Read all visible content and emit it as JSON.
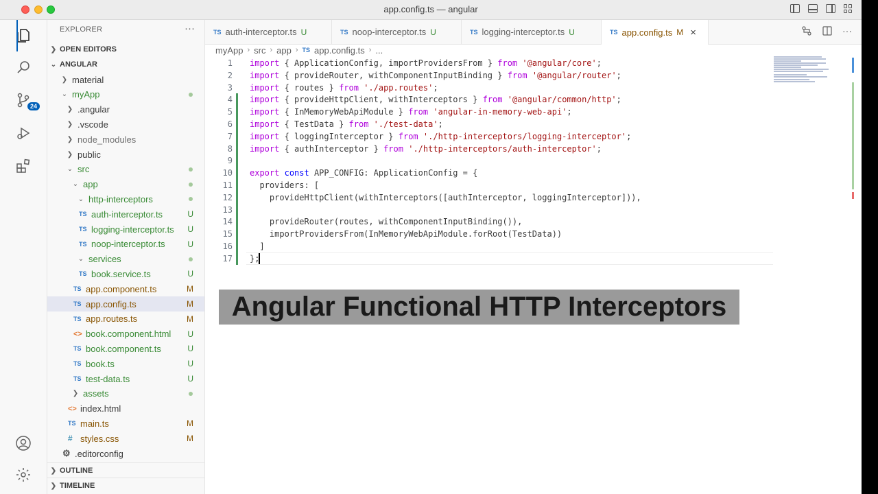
{
  "window": {
    "title": "app.config.ts — angular"
  },
  "activity": {
    "scm_badge": "24"
  },
  "explorer": {
    "header": "EXPLORER",
    "more": "···",
    "open_editors": "OPEN EDITORS",
    "root": "ANGULAR",
    "tree": [
      {
        "label": "material",
        "type": "folder",
        "status": ""
      },
      {
        "label": "myApp",
        "type": "folder",
        "status": "dot"
      },
      {
        "label": ".angular",
        "type": "folder",
        "status": ""
      },
      {
        "label": ".vscode",
        "type": "folder",
        "status": ""
      },
      {
        "label": "node_modules",
        "type": "folder",
        "status": ""
      },
      {
        "label": "public",
        "type": "folder",
        "status": ""
      },
      {
        "label": "src",
        "type": "folder",
        "status": "dot"
      },
      {
        "label": "app",
        "type": "folder",
        "status": "dot"
      },
      {
        "label": "http-interceptors",
        "type": "folder",
        "status": "dot"
      },
      {
        "label": "auth-interceptor.ts",
        "type": "ts",
        "status": "U"
      },
      {
        "label": "logging-interceptor.ts",
        "type": "ts",
        "status": "U"
      },
      {
        "label": "noop-interceptor.ts",
        "type": "ts",
        "status": "U"
      },
      {
        "label": "services",
        "type": "folder",
        "status": "dot"
      },
      {
        "label": "book.service.ts",
        "type": "ts",
        "status": "U"
      },
      {
        "label": "app.component.ts",
        "type": "ts",
        "status": "M"
      },
      {
        "label": "app.config.ts",
        "type": "ts",
        "status": "M"
      },
      {
        "label": "app.routes.ts",
        "type": "ts",
        "status": "M"
      },
      {
        "label": "book.component.html",
        "type": "html",
        "status": "U"
      },
      {
        "label": "book.component.ts",
        "type": "ts",
        "status": "U"
      },
      {
        "label": "book.ts",
        "type": "ts",
        "status": "U"
      },
      {
        "label": "test-data.ts",
        "type": "ts",
        "status": "U"
      },
      {
        "label": "assets",
        "type": "folder",
        "status": "dot"
      },
      {
        "label": "index.html",
        "type": "html",
        "status": ""
      },
      {
        "label": "main.ts",
        "type": "ts",
        "status": "M"
      },
      {
        "label": "styles.css",
        "type": "css",
        "status": "M"
      },
      {
        "label": ".editorconfig",
        "type": "gear",
        "status": ""
      }
    ],
    "outline": "OUTLINE",
    "timeline": "TIMELINE"
  },
  "tabs": [
    {
      "label": "auth-interceptor.ts",
      "status": "U"
    },
    {
      "label": "noop-interceptor.ts",
      "status": "U"
    },
    {
      "label": "logging-interceptor.ts",
      "status": "U"
    },
    {
      "label": "app.config.ts",
      "status": "M",
      "close": "×"
    }
  ],
  "breadcrumb": [
    "myApp",
    "src",
    "app",
    "app.config.ts",
    "..."
  ],
  "icons": {
    "ts": "TS",
    "html": "<>",
    "css": "#",
    "gear": "⚙",
    "chevron_right": "›",
    "chevron_closed": "❯",
    "chevron_open": "⌄"
  },
  "code": [
    {
      "n": "1",
      "t": "import { ApplicationConfig, importProvidersFrom } from '@angular/core';"
    },
    {
      "n": "2",
      "t": "import { provideRouter, withComponentInputBinding } from '@angular/router';"
    },
    {
      "n": "3",
      "t": "import { routes } from './app.routes';"
    },
    {
      "n": "4",
      "t": "import { provideHttpClient, withInterceptors } from '@angular/common/http';"
    },
    {
      "n": "5",
      "t": "import { InMemoryWebApiModule } from 'angular-in-memory-web-api';"
    },
    {
      "n": "6",
      "t": "import { TestData } from './test-data';"
    },
    {
      "n": "7",
      "t": "import { loggingInterceptor } from './http-interceptors/logging-interceptor';"
    },
    {
      "n": "8",
      "t": "import { authInterceptor } from './http-interceptors/auth-interceptor';"
    },
    {
      "n": "9",
      "t": ""
    },
    {
      "n": "10",
      "t": "export const APP_CONFIG: ApplicationConfig = {"
    },
    {
      "n": "11",
      "t": "  providers: ["
    },
    {
      "n": "12",
      "t": "    provideHttpClient(withInterceptors([authInterceptor, loggingInterceptor])),"
    },
    {
      "n": "13",
      "t": ""
    },
    {
      "n": "14",
      "t": "    provideRouter(routes, withComponentInputBinding()),"
    },
    {
      "n": "15",
      "t": "    importProvidersFrom(InMemoryWebApiModule.forRoot(TestData))"
    },
    {
      "n": "16",
      "t": "  ]"
    },
    {
      "n": "17",
      "t": "};"
    }
  ],
  "caption": "Angular Functional HTTP Interceptors",
  "colors": {
    "accent": "#005fb8",
    "modified": "#895503",
    "untracked": "#388a34",
    "keyword": "#0000ff",
    "string": "#a31515",
    "control": "#af00db"
  }
}
